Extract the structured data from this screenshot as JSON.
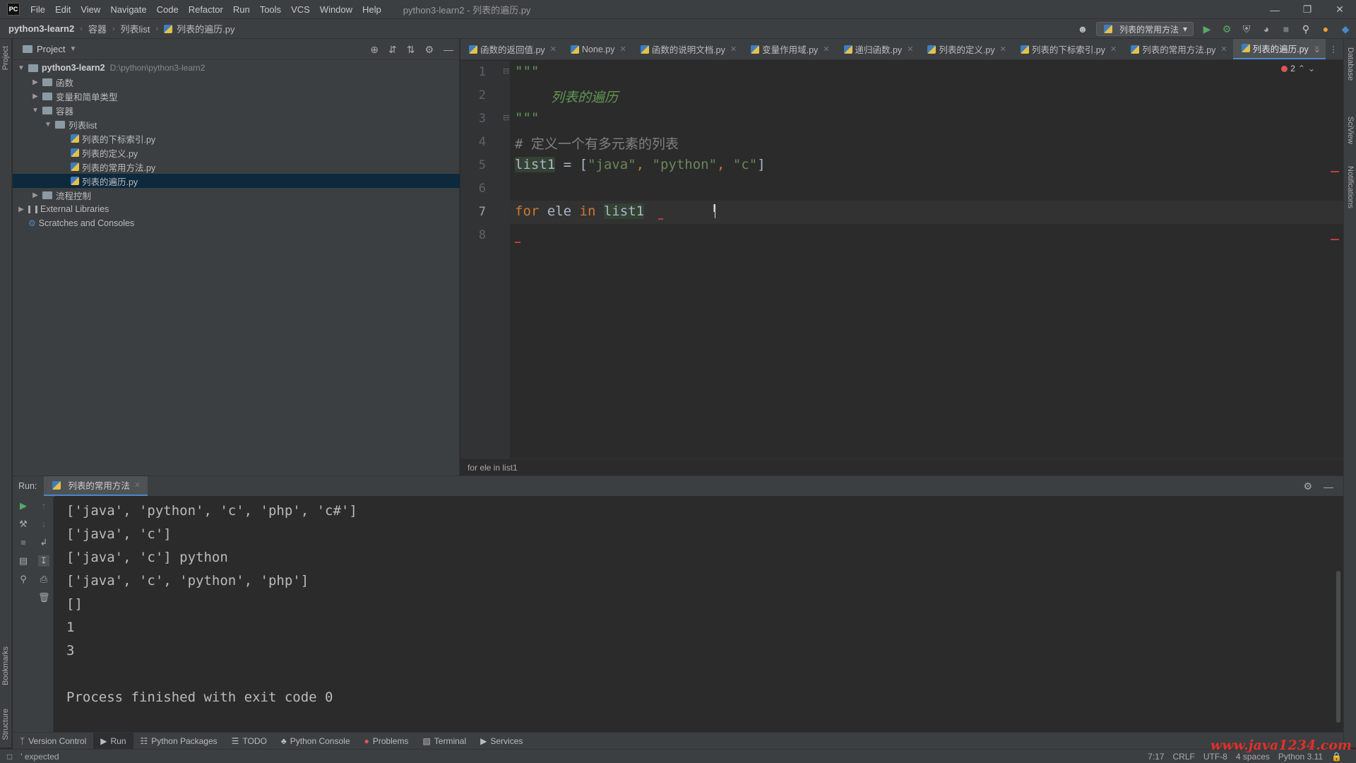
{
  "titlebar": {
    "logo": "PC",
    "menu": [
      "File",
      "Edit",
      "View",
      "Navigate",
      "Code",
      "Refactor",
      "Run",
      "Tools",
      "VCS",
      "Window",
      "Help"
    ],
    "window_title": "python3-learn2 - 列表的遍历.py",
    "controls": [
      "minimize-icon",
      "restore-icon",
      "close-icon"
    ]
  },
  "navbar": {
    "crumbs": [
      "python3-learn2",
      "容器",
      "列表list",
      "列表的遍历.py"
    ],
    "run_config": "列表的常用方法"
  },
  "project": {
    "title": "Project",
    "tree": [
      {
        "label": "python3-learn2",
        "hint": "D:\\python\\python3-learn2",
        "type": "root"
      },
      {
        "label": "函数",
        "type": "folder"
      },
      {
        "label": "变量和简单类型",
        "type": "folder"
      },
      {
        "label": "容器",
        "type": "folder"
      },
      {
        "label": "列表list",
        "type": "folder"
      },
      {
        "label": "列表的下标索引.py",
        "type": "file"
      },
      {
        "label": "列表的定义.py",
        "type": "file"
      },
      {
        "label": "列表的常用方法.py",
        "type": "file"
      },
      {
        "label": "列表的遍历.py",
        "type": "file",
        "selected": true
      },
      {
        "label": "流程控制",
        "type": "folder"
      },
      {
        "label": "External Libraries",
        "type": "lib"
      },
      {
        "label": "Scratches and Consoles",
        "type": "scratch"
      }
    ]
  },
  "tabs": [
    "函数的返回值.py",
    "None.py",
    "函数的说明文档.py",
    "变量作用域.py",
    "递归函数.py",
    "列表的定义.py",
    "列表的下标索引.py",
    "列表的常用方法.py",
    "列表的遍历.py"
  ],
  "active_tab": "列表的遍历.py",
  "editor": {
    "line_numbers": [
      "1",
      "2",
      "3",
      "4",
      "5",
      "6",
      "7",
      "8"
    ],
    "docstring_open": "\"\"\"",
    "docstring_text": "列表的遍历",
    "docstring_close": "\"\"\"",
    "comment": "# 定义一个有多元素的列表",
    "line5": {
      "var": "list1",
      "eq": " = [",
      "s1": "\"java\"",
      "c1": ", ",
      "s2": "\"python\"",
      "c2": ", ",
      "s3": "\"c\"",
      "end": "]"
    },
    "line7": {
      "kw1": "for",
      "mid": " ele ",
      "kw2": "in",
      "var": "list1"
    },
    "error_count": "2",
    "breadcrumb": "for ele in list1"
  },
  "run": {
    "label": "Run:",
    "tab": "列表的常用方法",
    "output": [
      "['java', 'python', 'c', 'php', 'c#']",
      "['java', 'c']",
      "['java', 'c'] python",
      "['java', 'c', 'python', 'php']",
      "[]",
      "1",
      "3",
      "",
      "Process finished with exit code 0"
    ]
  },
  "bottom_tools": [
    "Version Control",
    "Run",
    "Python Packages",
    "TODO",
    "Python Console",
    "Problems",
    "Terminal",
    "Services"
  ],
  "side_labels": {
    "project": "Project",
    "bookmarks": "Bookmarks",
    "structure": "Structure",
    "database": "Database",
    "sciview": "SciView",
    "notifications": "Notifications"
  },
  "status": {
    "message": "' expected",
    "position": "7:17",
    "line_sep": "CRLF",
    "encoding": "UTF-8",
    "indent": "4 spaces",
    "interpreter": "Python 3.11"
  },
  "watermark": "www.java1234.com",
  "colors": {
    "accent": "#4a88c7",
    "keyword": "#cc7832",
    "string": "#6a8759",
    "error": "#bc3f3c"
  }
}
